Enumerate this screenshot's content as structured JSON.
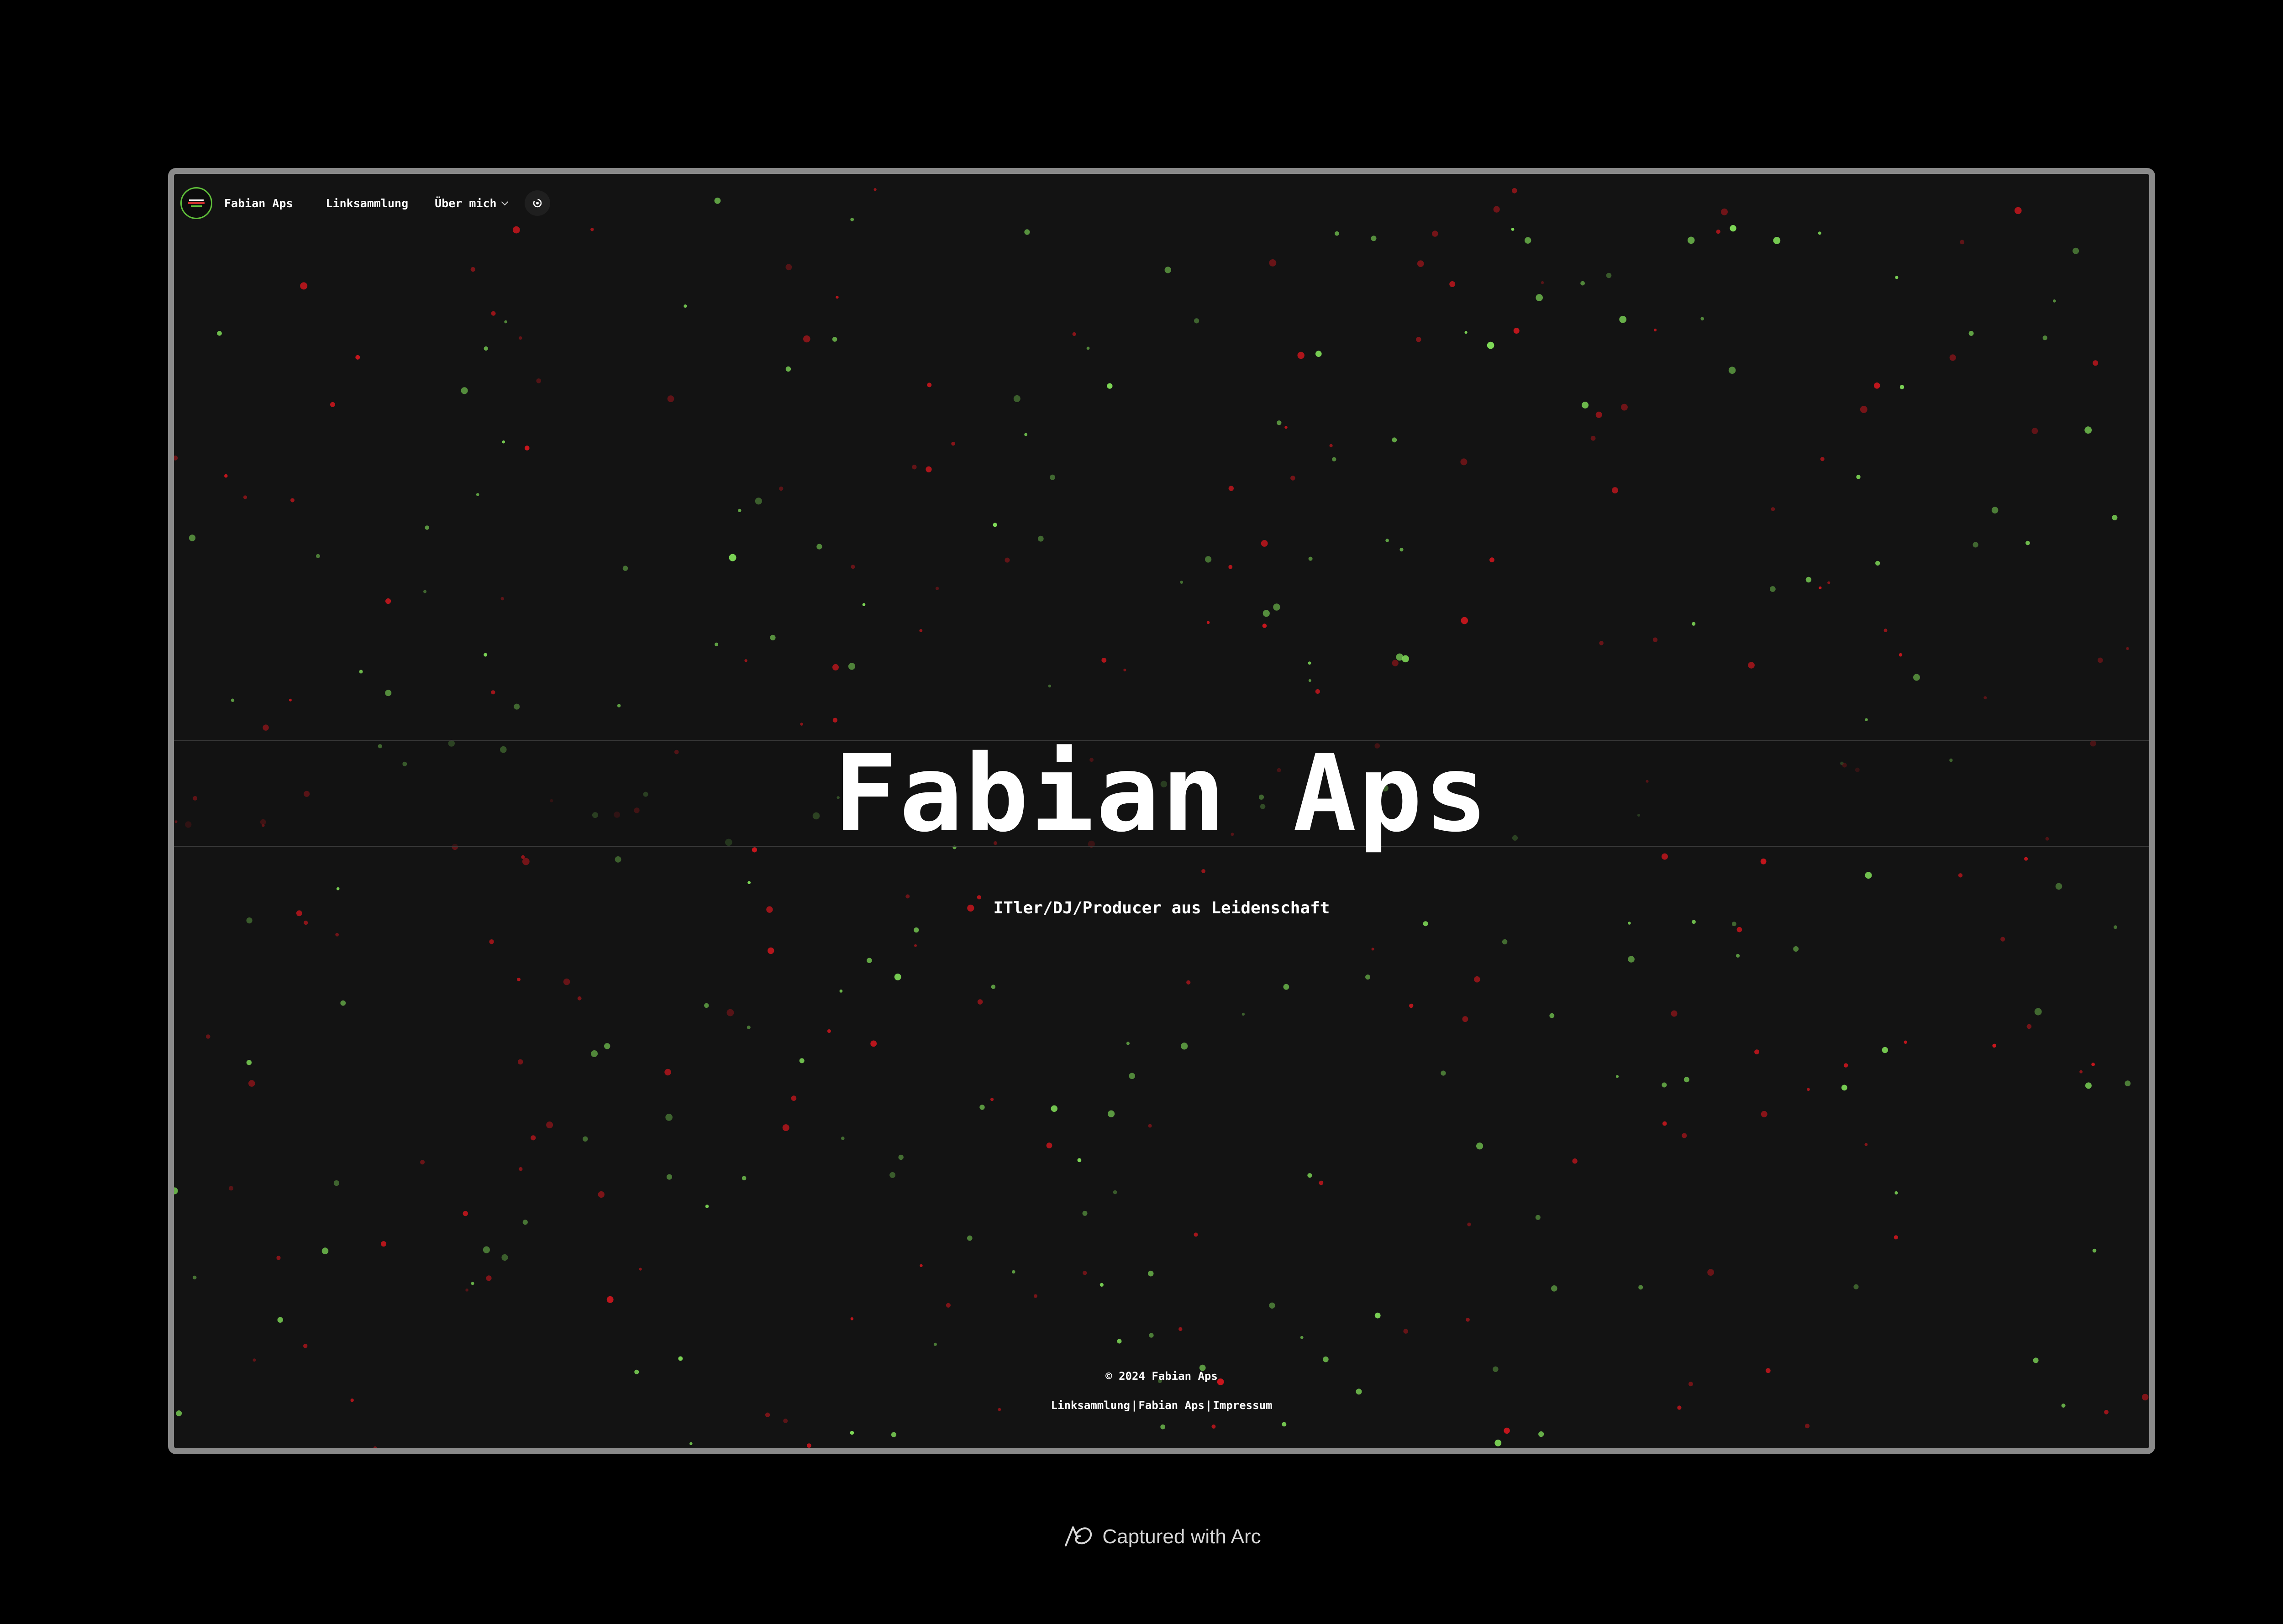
{
  "nav": {
    "brand": "Fabian Aps",
    "links": [
      "Linksammlung"
    ],
    "dropdown_label": "Über mich",
    "logo_icon": "circle-logo-icon",
    "theme_icon": "theme-toggle-icon"
  },
  "hero": {
    "title": "Fabian Aps",
    "subtitle": "ITler/DJ/Producer aus Leidenschaft"
  },
  "footer": {
    "copyright": "© 2024 Fabian Aps",
    "links": [
      "Linksammlung",
      "Fabian Aps",
      "Impressum"
    ],
    "separator": "|"
  },
  "capture": {
    "label": "Captured with Arc",
    "icon": "arc-logo-icon"
  },
  "colors": {
    "background": "#131313",
    "particle_green": "#7ed957",
    "particle_red": "#c8161d",
    "accent_green": "#5fbf3a"
  }
}
